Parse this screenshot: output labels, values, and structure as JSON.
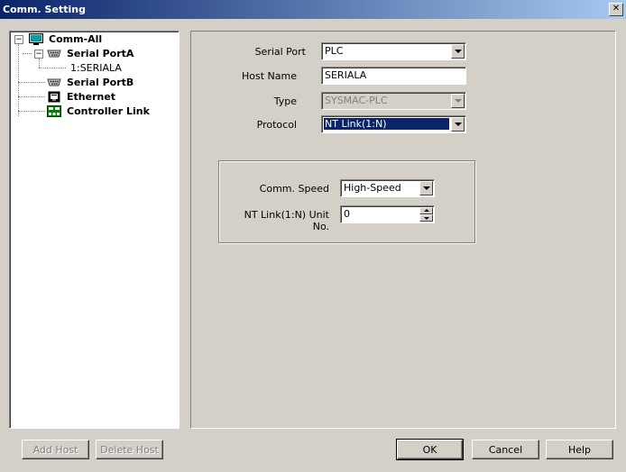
{
  "window": {
    "title": "Comm. Setting",
    "close_glyph": "✕"
  },
  "tree": {
    "items": [
      {
        "label": "Comm-All",
        "icon": "monitor-icon",
        "expander": "−"
      },
      {
        "label": "Serial PortA",
        "icon": "serial-port-icon",
        "expander": "−"
      },
      {
        "label": "1:SERIALA"
      },
      {
        "label": "Serial PortB",
        "icon": "serial-port-icon"
      },
      {
        "label": "Ethernet",
        "icon": "ethernet-icon"
      },
      {
        "label": "Controller Link",
        "icon": "controller-link-icon"
      }
    ]
  },
  "form": {
    "serial_port": {
      "label": "Serial Port",
      "value": "PLC"
    },
    "host_name": {
      "label": "Host Name",
      "value": "SERIALA"
    },
    "type": {
      "label": "Type",
      "value": "SYSMAC-PLC"
    },
    "protocol": {
      "label": "Protocol",
      "value": "NT Link(1:N)"
    },
    "comm_speed": {
      "label": "Comm. Speed",
      "value": "High-Speed"
    },
    "unit_no": {
      "label": "NT Link(1:N) Unit No.",
      "value": "0"
    }
  },
  "buttons": {
    "add_host": "Add Host",
    "delete_host": "Delete Host",
    "ok": "OK",
    "cancel": "Cancel",
    "help": "Help"
  },
  "colors": {
    "title_start": "#0a246a",
    "title_end": "#a6caf0",
    "selection": "#0a246a",
    "face": "#d4d0c8"
  }
}
